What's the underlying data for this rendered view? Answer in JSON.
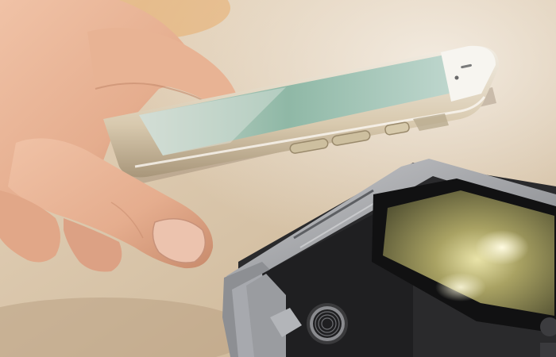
{
  "scene": {
    "subjects": [
      "hand",
      "smartphone",
      "payment-terminal"
    ],
    "colors": {
      "background_warm": "#dcc7aa",
      "background_light": "#efe6d8",
      "skin": "#e9b699",
      "skin_shadow": "#c98f72",
      "phone_frame": "#d9cdb8",
      "phone_screen": "#a9c6b8",
      "terminal_body": "#2b2b2d",
      "terminal_silver": "#a7a9ad",
      "terminal_screen": "#8b8a55"
    }
  }
}
